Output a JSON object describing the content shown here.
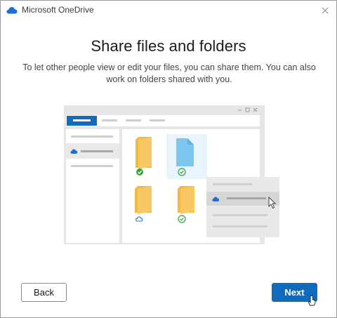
{
  "window": {
    "app_title": "Microsoft OneDrive",
    "heading": "Share files and folders",
    "description": "To let other people view or edit your files, you can share them. You can also work on folders shared with you."
  },
  "buttons": {
    "back_label": "Back",
    "next_label": "Next"
  },
  "icons": {
    "app": "onedrive-cloud-icon",
    "close": "close-icon",
    "illustration": "share-illustration"
  },
  "colors": {
    "accent": "#0f6cbd",
    "cloud": "#1d6fd6",
    "folder": "#f5b841",
    "file": "#7cc7f0",
    "check": "#3aa13f",
    "illustration_bg": "#e6e6e6"
  }
}
